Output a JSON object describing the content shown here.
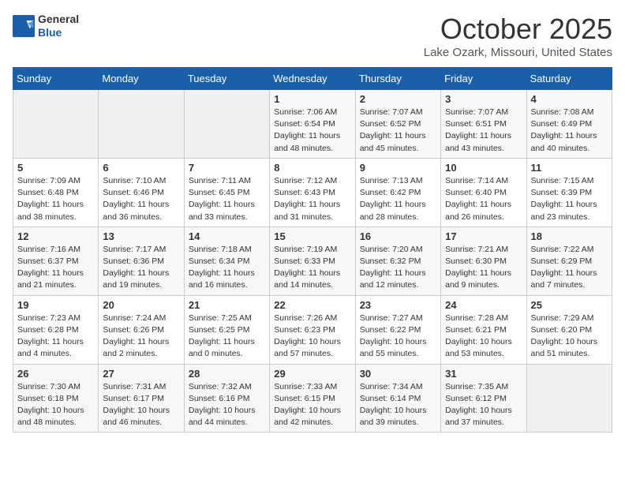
{
  "header": {
    "logo_general": "General",
    "logo_blue": "Blue",
    "title": "October 2025",
    "subtitle": "Lake Ozark, Missouri, United States"
  },
  "days_of_week": [
    "Sunday",
    "Monday",
    "Tuesday",
    "Wednesday",
    "Thursday",
    "Friday",
    "Saturday"
  ],
  "weeks": [
    [
      {
        "day": "",
        "content": ""
      },
      {
        "day": "",
        "content": ""
      },
      {
        "day": "",
        "content": ""
      },
      {
        "day": "1",
        "content": "Sunrise: 7:06 AM\nSunset: 6:54 PM\nDaylight: 11 hours\nand 48 minutes."
      },
      {
        "day": "2",
        "content": "Sunrise: 7:07 AM\nSunset: 6:52 PM\nDaylight: 11 hours\nand 45 minutes."
      },
      {
        "day": "3",
        "content": "Sunrise: 7:07 AM\nSunset: 6:51 PM\nDaylight: 11 hours\nand 43 minutes."
      },
      {
        "day": "4",
        "content": "Sunrise: 7:08 AM\nSunset: 6:49 PM\nDaylight: 11 hours\nand 40 minutes."
      }
    ],
    [
      {
        "day": "5",
        "content": "Sunrise: 7:09 AM\nSunset: 6:48 PM\nDaylight: 11 hours\nand 38 minutes."
      },
      {
        "day": "6",
        "content": "Sunrise: 7:10 AM\nSunset: 6:46 PM\nDaylight: 11 hours\nand 36 minutes."
      },
      {
        "day": "7",
        "content": "Sunrise: 7:11 AM\nSunset: 6:45 PM\nDaylight: 11 hours\nand 33 minutes."
      },
      {
        "day": "8",
        "content": "Sunrise: 7:12 AM\nSunset: 6:43 PM\nDaylight: 11 hours\nand 31 minutes."
      },
      {
        "day": "9",
        "content": "Sunrise: 7:13 AM\nSunset: 6:42 PM\nDaylight: 11 hours\nand 28 minutes."
      },
      {
        "day": "10",
        "content": "Sunrise: 7:14 AM\nSunset: 6:40 PM\nDaylight: 11 hours\nand 26 minutes."
      },
      {
        "day": "11",
        "content": "Sunrise: 7:15 AM\nSunset: 6:39 PM\nDaylight: 11 hours\nand 23 minutes."
      }
    ],
    [
      {
        "day": "12",
        "content": "Sunrise: 7:16 AM\nSunset: 6:37 PM\nDaylight: 11 hours\nand 21 minutes."
      },
      {
        "day": "13",
        "content": "Sunrise: 7:17 AM\nSunset: 6:36 PM\nDaylight: 11 hours\nand 19 minutes."
      },
      {
        "day": "14",
        "content": "Sunrise: 7:18 AM\nSunset: 6:34 PM\nDaylight: 11 hours\nand 16 minutes."
      },
      {
        "day": "15",
        "content": "Sunrise: 7:19 AM\nSunset: 6:33 PM\nDaylight: 11 hours\nand 14 minutes."
      },
      {
        "day": "16",
        "content": "Sunrise: 7:20 AM\nSunset: 6:32 PM\nDaylight: 11 hours\nand 12 minutes."
      },
      {
        "day": "17",
        "content": "Sunrise: 7:21 AM\nSunset: 6:30 PM\nDaylight: 11 hours\nand 9 minutes."
      },
      {
        "day": "18",
        "content": "Sunrise: 7:22 AM\nSunset: 6:29 PM\nDaylight: 11 hours\nand 7 minutes."
      }
    ],
    [
      {
        "day": "19",
        "content": "Sunrise: 7:23 AM\nSunset: 6:28 PM\nDaylight: 11 hours\nand 4 minutes."
      },
      {
        "day": "20",
        "content": "Sunrise: 7:24 AM\nSunset: 6:26 PM\nDaylight: 11 hours\nand 2 minutes."
      },
      {
        "day": "21",
        "content": "Sunrise: 7:25 AM\nSunset: 6:25 PM\nDaylight: 11 hours\nand 0 minutes."
      },
      {
        "day": "22",
        "content": "Sunrise: 7:26 AM\nSunset: 6:23 PM\nDaylight: 10 hours\nand 57 minutes."
      },
      {
        "day": "23",
        "content": "Sunrise: 7:27 AM\nSunset: 6:22 PM\nDaylight: 10 hours\nand 55 minutes."
      },
      {
        "day": "24",
        "content": "Sunrise: 7:28 AM\nSunset: 6:21 PM\nDaylight: 10 hours\nand 53 minutes."
      },
      {
        "day": "25",
        "content": "Sunrise: 7:29 AM\nSunset: 6:20 PM\nDaylight: 10 hours\nand 51 minutes."
      }
    ],
    [
      {
        "day": "26",
        "content": "Sunrise: 7:30 AM\nSunset: 6:18 PM\nDaylight: 10 hours\nand 48 minutes."
      },
      {
        "day": "27",
        "content": "Sunrise: 7:31 AM\nSunset: 6:17 PM\nDaylight: 10 hours\nand 46 minutes."
      },
      {
        "day": "28",
        "content": "Sunrise: 7:32 AM\nSunset: 6:16 PM\nDaylight: 10 hours\nand 44 minutes."
      },
      {
        "day": "29",
        "content": "Sunrise: 7:33 AM\nSunset: 6:15 PM\nDaylight: 10 hours\nand 42 minutes."
      },
      {
        "day": "30",
        "content": "Sunrise: 7:34 AM\nSunset: 6:14 PM\nDaylight: 10 hours\nand 39 minutes."
      },
      {
        "day": "31",
        "content": "Sunrise: 7:35 AM\nSunset: 6:12 PM\nDaylight: 10 hours\nand 37 minutes."
      },
      {
        "day": "",
        "content": ""
      }
    ]
  ]
}
